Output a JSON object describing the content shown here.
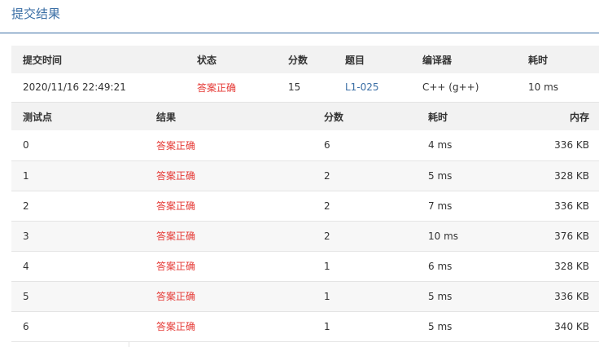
{
  "header": {
    "title": "提交结果",
    "accent_color": "#3a6ea5"
  },
  "summary": {
    "columns": [
      "提交时间",
      "状态",
      "分数",
      "题目",
      "编译器",
      "耗时"
    ],
    "row": {
      "time": "2020/11/16 22:49:21",
      "status": "答案正确",
      "score": "15",
      "problem": "L1-025",
      "compiler": "C++ (g++)",
      "elapsed": "10 ms"
    }
  },
  "testcases": {
    "columns": [
      "测试点",
      "结果",
      "分数",
      "耗时",
      "内存"
    ],
    "rows": [
      {
        "id": "0",
        "result": "答案正确",
        "score": "6",
        "time": "4 ms",
        "memory": "336 KB"
      },
      {
        "id": "1",
        "result": "答案正确",
        "score": "2",
        "time": "5 ms",
        "memory": "328 KB"
      },
      {
        "id": "2",
        "result": "答案正确",
        "score": "2",
        "time": "7 ms",
        "memory": "336 KB"
      },
      {
        "id": "3",
        "result": "答案正确",
        "score": "2",
        "time": "10 ms",
        "memory": "376 KB"
      },
      {
        "id": "4",
        "result": "答案正确",
        "score": "1",
        "time": "6 ms",
        "memory": "328 KB"
      },
      {
        "id": "5",
        "result": "答案正确",
        "score": "1",
        "time": "5 ms",
        "memory": "336 KB"
      },
      {
        "id": "6",
        "result": "答案正确",
        "score": "1",
        "time": "5 ms",
        "memory": "340 KB"
      }
    ]
  },
  "colors": {
    "status_accepted": "#e53935",
    "header_bg": "#f2f2f2",
    "link": "#3a6ea5"
  }
}
